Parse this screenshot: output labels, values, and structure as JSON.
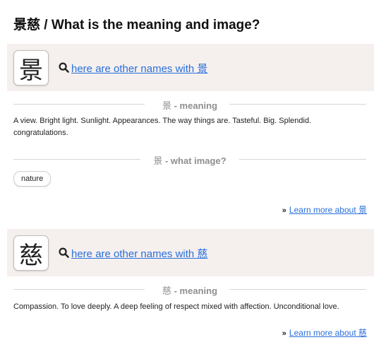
{
  "page": {
    "title": "景慈 / What is the meaning and image?"
  },
  "kanji": [
    {
      "character": "景",
      "names_link": "here are other names with 景",
      "meaning_header": "景 - meaning",
      "meaning_header_kanji": "景",
      "meaning_header_text": " - meaning",
      "meaning": "A view. Bright light. Sunlight. Appearances. The way things are. Tasteful. Big. Splendid. congratulations.",
      "image_header_kanji": "景",
      "image_header_text": " - what image?",
      "image_tags": [
        "nature"
      ],
      "learn_more": "Learn more about 景"
    },
    {
      "character": "慈",
      "names_link": "here are other names with 慈",
      "meaning_header_kanji": "慈",
      "meaning_header_text": " - meaning",
      "meaning": "Compassion. To love deeply. A deep feeling of respect mixed with affection. Unconditional love.",
      "learn_more": "Learn more about 慈"
    }
  ],
  "icons": {
    "search": "search-icon",
    "arrows": "double-chevron-right-icon"
  },
  "colors": {
    "band_background": "#f5f0ee",
    "link": "#2a6fdb",
    "section_label": "#8f8f8f"
  }
}
